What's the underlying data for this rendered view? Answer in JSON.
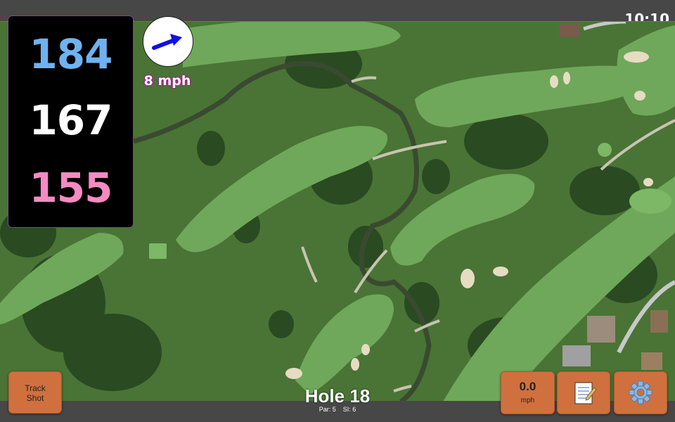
{
  "status": {
    "time": "10:10"
  },
  "distances": {
    "back": "184",
    "middle": "167",
    "front": "155"
  },
  "wind": {
    "speed_label": "8 mph",
    "indicator_icon": "wind-direction-arrow-icon",
    "arrow_color": "#1010e0"
  },
  "buttons": {
    "track_shot": {
      "line1": "Track",
      "line2": "Shot"
    },
    "wind_speed": {
      "value": "0.0",
      "unit": "mph"
    },
    "notes": {
      "icon": "notepad-icon"
    },
    "settings": {
      "icon": "gear-icon"
    }
  },
  "hole": {
    "title": "Hole 18",
    "par": "Par: 5",
    "si": "SI: 6"
  },
  "colors": {
    "back_distance": "#6fb2ef",
    "middle_distance": "#ffffff",
    "front_distance": "#f48bc2",
    "button": "#d0703e",
    "bar": "#474747"
  }
}
